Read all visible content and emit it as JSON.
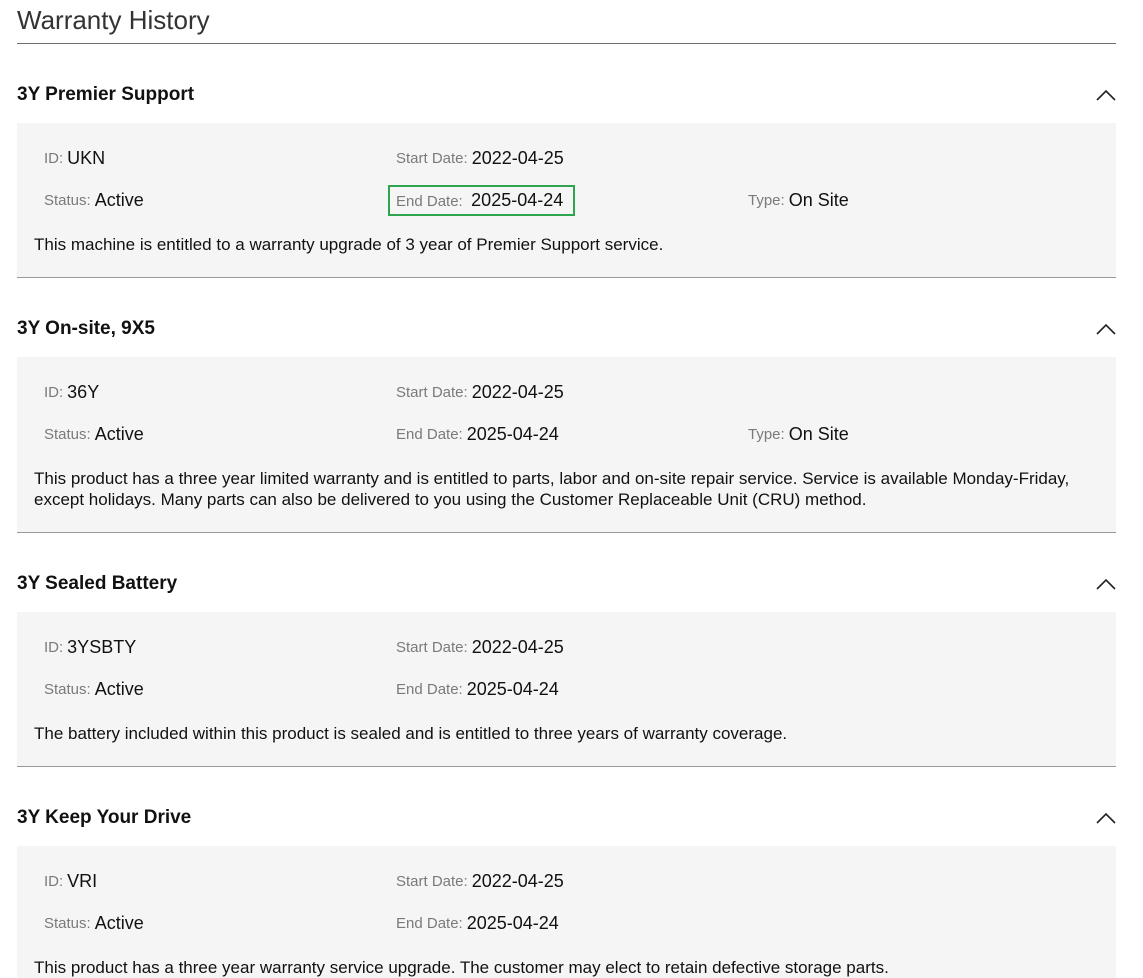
{
  "page": {
    "title": "Warranty History"
  },
  "labels": {
    "id": "ID",
    "start_date": "Start Date",
    "end_date": "End Date",
    "status": "Status",
    "type": "Type"
  },
  "highlight_color": "#2ea44f",
  "sections": [
    {
      "title": "3Y Premier Support",
      "expanded": true,
      "icon": "chevron-up-icon",
      "id": "UKN",
      "start_date": "2022-04-25",
      "status": "Active",
      "end_date": "2025-04-24",
      "type": "On Site",
      "description": "This machine is entitled to a warranty upgrade of 3 year of Premier Support service."
    },
    {
      "title": "3Y On-site, 9X5",
      "expanded": true,
      "icon": "chevron-up-icon",
      "id": "36Y",
      "start_date": "2022-04-25",
      "status": "Active",
      "end_date": "2025-04-24",
      "type": "On Site",
      "description": "This product has a three year limited warranty and is entitled to parts, labor and on-site repair service. Service is available Monday-Friday, except holidays. Many parts can also be delivered to you using the Customer Replaceable Unit (CRU) method."
    },
    {
      "title": "3Y Sealed Battery",
      "expanded": true,
      "icon": "chevron-up-icon",
      "id": "3YSBTY",
      "start_date": "2022-04-25",
      "status": "Active",
      "end_date": "2025-04-24",
      "description": "The battery included within this product is sealed and is entitled to three years of warranty coverage."
    },
    {
      "title": "3Y Keep Your Drive",
      "expanded": true,
      "icon": "chevron-up-icon",
      "id": "VRI",
      "start_date": "2022-04-25",
      "status": "Active",
      "end_date": "2025-04-24",
      "description": "This product has a three year warranty service upgrade. The customer may elect to retain defective storage parts."
    }
  ]
}
